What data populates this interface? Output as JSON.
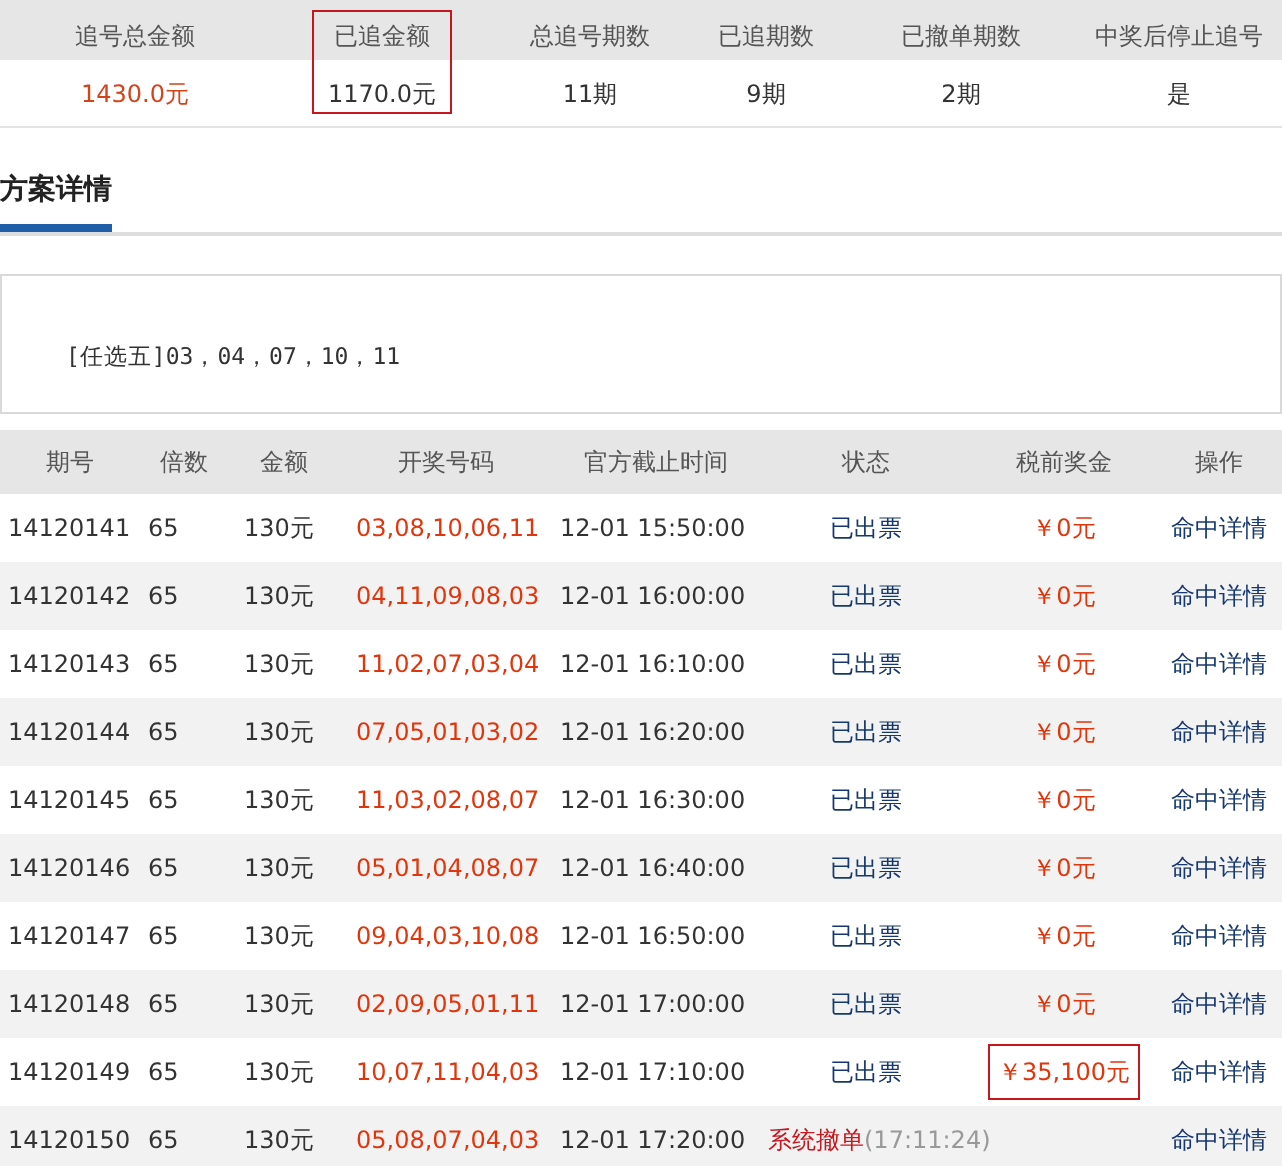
{
  "summary": {
    "columns": [
      {
        "label": "追号总金额",
        "value": "1430.0元",
        "highlighted": false,
        "emphasis": true
      },
      {
        "label": "已追金额",
        "value": "1170.0元",
        "highlighted": true,
        "emphasis": false
      },
      {
        "label": "总追号期数",
        "value": "11期",
        "highlighted": false,
        "emphasis": false
      },
      {
        "label": "已追期数",
        "value": "9期",
        "highlighted": false,
        "emphasis": false
      },
      {
        "label": "已撤单期数",
        "value": "2期",
        "highlighted": false,
        "emphasis": false
      },
      {
        "label": "中奖后停止追号",
        "value": "是",
        "highlighted": false,
        "emphasis": false
      }
    ]
  },
  "tabs": [
    {
      "label": "方案详情",
      "selected": true
    }
  ],
  "scheme": {
    "text": "[任选五]03，04，07，10，11"
  },
  "table": {
    "columns": [
      "期号",
      "倍数",
      "金额",
      "开奖号码",
      "官方截止时间",
      "状态",
      "税前奖金",
      "操作"
    ],
    "rows": [
      {
        "issue": "14120141",
        "multiple": "65",
        "amount": "130元",
        "numbers": "03,08,10,06,11",
        "deadline": "12-01 15:50:00",
        "kind": "issued",
        "status": "已出票",
        "prize": "￥0元",
        "prize_highlighted": false,
        "action": "命中详情"
      },
      {
        "issue": "14120142",
        "multiple": "65",
        "amount": "130元",
        "numbers": "04,11,09,08,03",
        "deadline": "12-01 16:00:00",
        "kind": "issued",
        "status": "已出票",
        "prize": "￥0元",
        "prize_highlighted": false,
        "action": "命中详情"
      },
      {
        "issue": "14120143",
        "multiple": "65",
        "amount": "130元",
        "numbers": "11,02,07,03,04",
        "deadline": "12-01 16:10:00",
        "kind": "issued",
        "status": "已出票",
        "prize": "￥0元",
        "prize_highlighted": false,
        "action": "命中详情"
      },
      {
        "issue": "14120144",
        "multiple": "65",
        "amount": "130元",
        "numbers": "07,05,01,03,02",
        "deadline": "12-01 16:20:00",
        "kind": "issued",
        "status": "已出票",
        "prize": "￥0元",
        "prize_highlighted": false,
        "action": "命中详情"
      },
      {
        "issue": "14120145",
        "multiple": "65",
        "amount": "130元",
        "numbers": "11,03,02,08,07",
        "deadline": "12-01 16:30:00",
        "kind": "issued",
        "status": "已出票",
        "prize": "￥0元",
        "prize_highlighted": false,
        "action": "命中详情"
      },
      {
        "issue": "14120146",
        "multiple": "65",
        "amount": "130元",
        "numbers": "05,01,04,08,07",
        "deadline": "12-01 16:40:00",
        "kind": "issued",
        "status": "已出票",
        "prize": "￥0元",
        "prize_highlighted": false,
        "action": "命中详情"
      },
      {
        "issue": "14120147",
        "multiple": "65",
        "amount": "130元",
        "numbers": "09,04,03,10,08",
        "deadline": "12-01 16:50:00",
        "kind": "issued",
        "status": "已出票",
        "prize": "￥0元",
        "prize_highlighted": false,
        "action": "命中详情"
      },
      {
        "issue": "14120148",
        "multiple": "65",
        "amount": "130元",
        "numbers": "02,09,05,01,11",
        "deadline": "12-01 17:00:00",
        "kind": "issued",
        "status": "已出票",
        "prize": "￥0元",
        "prize_highlighted": false,
        "action": "命中详情"
      },
      {
        "issue": "14120149",
        "multiple": "65",
        "amount": "130元",
        "numbers": "10,07,11,04,03",
        "deadline": "12-01 17:10:00",
        "kind": "issued",
        "status": "已出票",
        "prize": "￥35,100元",
        "prize_highlighted": true,
        "action": "命中详情"
      },
      {
        "issue": "14120150",
        "multiple": "65",
        "amount": "130元",
        "numbers": "05,08,07,04,03",
        "deadline": "12-01 17:20:00",
        "kind": "cancelled",
        "status": "系统撤单",
        "status_time": "(17:11:24)",
        "action": "命中详情"
      }
    ]
  }
}
